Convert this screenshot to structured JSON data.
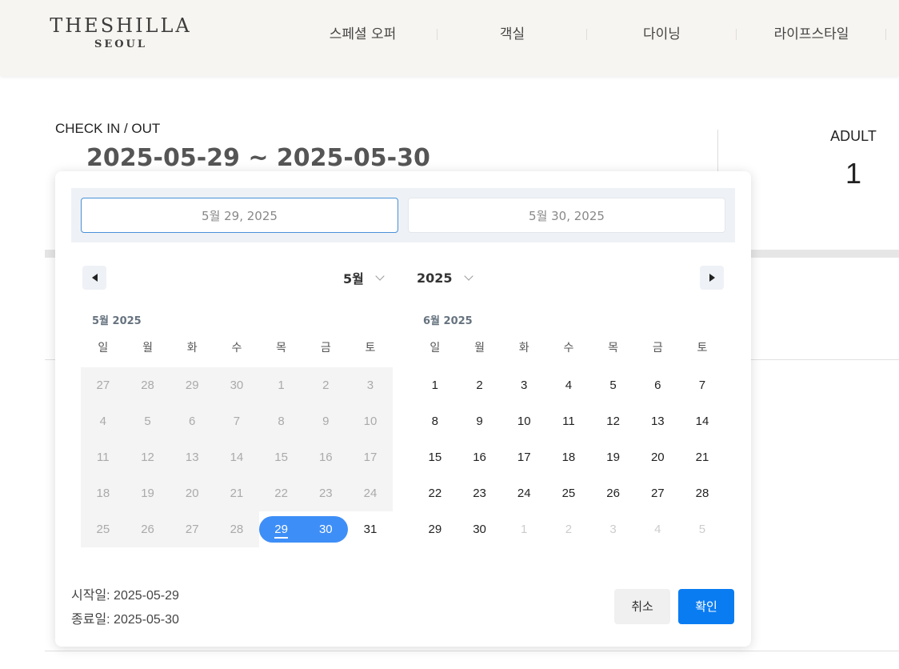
{
  "header": {
    "logo_main": "THESHILLA",
    "logo_sub": "SEOUL",
    "nav": [
      "스페셜 오퍼",
      "객실",
      "다이닝",
      "라이프스타일"
    ]
  },
  "booking": {
    "checkin_label": "CHECK IN / OUT",
    "checkin_value": "2025-05-29 ~ 2025-05-30",
    "adult_label": "ADULT",
    "adult_value": "1"
  },
  "picker": {
    "start_field": "5월 29, 2025",
    "end_field": "5월 30, 2025",
    "month_select": "5월",
    "year_select": "2025",
    "weekdays": [
      "일",
      "월",
      "화",
      "수",
      "목",
      "금",
      "토"
    ],
    "months": [
      {
        "title": "5월 2025",
        "days": [
          {
            "d": "27",
            "s": "disabled"
          },
          {
            "d": "28",
            "s": "disabled"
          },
          {
            "d": "29",
            "s": "disabled"
          },
          {
            "d": "30",
            "s": "disabled"
          },
          {
            "d": "1",
            "s": "disabled"
          },
          {
            "d": "2",
            "s": "disabled"
          },
          {
            "d": "3",
            "s": "disabled"
          },
          {
            "d": "4",
            "s": "disabled"
          },
          {
            "d": "5",
            "s": "disabled"
          },
          {
            "d": "6",
            "s": "disabled"
          },
          {
            "d": "7",
            "s": "disabled"
          },
          {
            "d": "8",
            "s": "disabled"
          },
          {
            "d": "9",
            "s": "disabled"
          },
          {
            "d": "10",
            "s": "disabled"
          },
          {
            "d": "11",
            "s": "disabled"
          },
          {
            "d": "12",
            "s": "disabled"
          },
          {
            "d": "13",
            "s": "disabled"
          },
          {
            "d": "14",
            "s": "disabled"
          },
          {
            "d": "15",
            "s": "disabled"
          },
          {
            "d": "16",
            "s": "disabled"
          },
          {
            "d": "17",
            "s": "disabled"
          },
          {
            "d": "18",
            "s": "disabled"
          },
          {
            "d": "19",
            "s": "disabled"
          },
          {
            "d": "20",
            "s": "disabled"
          },
          {
            "d": "21",
            "s": "disabled"
          },
          {
            "d": "22",
            "s": "disabled"
          },
          {
            "d": "23",
            "s": "disabled"
          },
          {
            "d": "24",
            "s": "disabled"
          },
          {
            "d": "25",
            "s": "disabled"
          },
          {
            "d": "26",
            "s": "disabled"
          },
          {
            "d": "27",
            "s": "disabled"
          },
          {
            "d": "28",
            "s": "disabled"
          },
          {
            "d": "29",
            "s": "sel-start"
          },
          {
            "d": "30",
            "s": "sel-end"
          },
          {
            "d": "31",
            "s": "normal"
          }
        ]
      },
      {
        "title": "6월 2025",
        "days": [
          {
            "d": "1",
            "s": "normal"
          },
          {
            "d": "2",
            "s": "normal"
          },
          {
            "d": "3",
            "s": "normal"
          },
          {
            "d": "4",
            "s": "normal"
          },
          {
            "d": "5",
            "s": "normal"
          },
          {
            "d": "6",
            "s": "normal"
          },
          {
            "d": "7",
            "s": "normal"
          },
          {
            "d": "8",
            "s": "normal"
          },
          {
            "d": "9",
            "s": "normal"
          },
          {
            "d": "10",
            "s": "normal"
          },
          {
            "d": "11",
            "s": "normal"
          },
          {
            "d": "12",
            "s": "normal"
          },
          {
            "d": "13",
            "s": "normal"
          },
          {
            "d": "14",
            "s": "normal"
          },
          {
            "d": "15",
            "s": "normal"
          },
          {
            "d": "16",
            "s": "normal"
          },
          {
            "d": "17",
            "s": "normal"
          },
          {
            "d": "18",
            "s": "normal"
          },
          {
            "d": "19",
            "s": "normal"
          },
          {
            "d": "20",
            "s": "normal"
          },
          {
            "d": "21",
            "s": "normal"
          },
          {
            "d": "22",
            "s": "normal"
          },
          {
            "d": "23",
            "s": "normal"
          },
          {
            "d": "24",
            "s": "normal"
          },
          {
            "d": "25",
            "s": "normal"
          },
          {
            "d": "26",
            "s": "normal"
          },
          {
            "d": "27",
            "s": "normal"
          },
          {
            "d": "28",
            "s": "normal"
          },
          {
            "d": "29",
            "s": "normal"
          },
          {
            "d": "30",
            "s": "normal"
          },
          {
            "d": "1",
            "s": "muted"
          },
          {
            "d": "2",
            "s": "muted"
          },
          {
            "d": "3",
            "s": "muted"
          },
          {
            "d": "4",
            "s": "muted"
          },
          {
            "d": "5",
            "s": "muted"
          }
        ]
      }
    ],
    "start_summary": "시작일: 2025-05-29",
    "end_summary": "종료일: 2025-05-30",
    "cancel_label": "취소",
    "confirm_label": "확인",
    "accent_color": "#3e8ef7"
  }
}
